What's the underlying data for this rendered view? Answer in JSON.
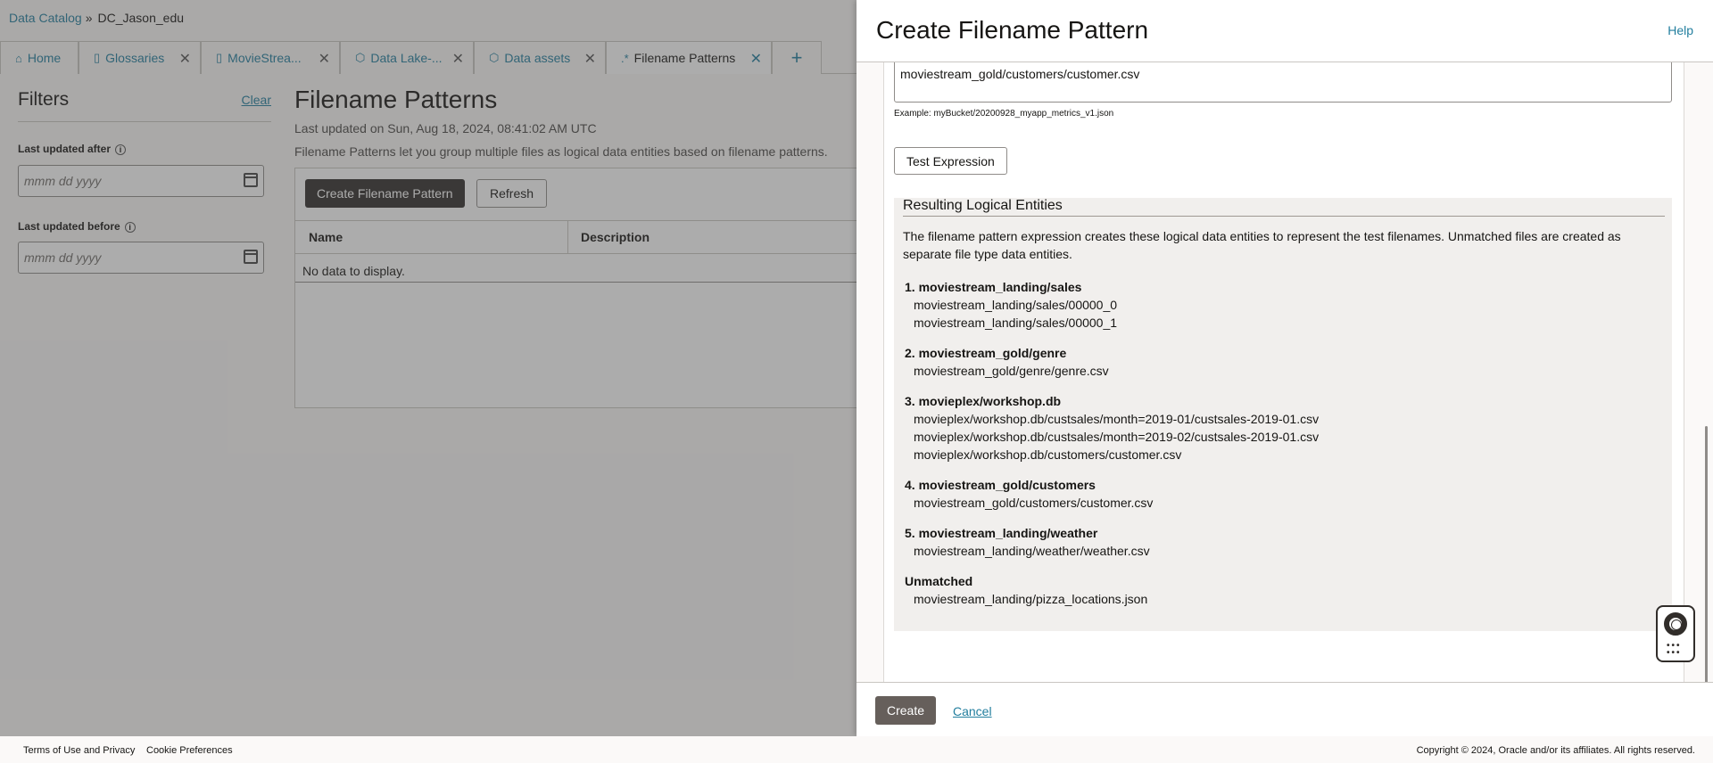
{
  "breadcrumb": {
    "root": "Data Catalog",
    "separator": "»",
    "current": "DC_Jason_edu"
  },
  "tabs": [
    {
      "label": "Home",
      "icon": "home-icon",
      "glyph": "⌂",
      "closable": false
    },
    {
      "label": "Glossaries",
      "icon": "book-icon",
      "glyph": "📖",
      "closable": true
    },
    {
      "label": "MovieStrea...",
      "icon": "book-icon",
      "glyph": "📖",
      "closable": true
    },
    {
      "label": "Data Lake-...",
      "icon": "cube-icon",
      "glyph": "⬡",
      "closable": true
    },
    {
      "label": "Data assets",
      "icon": "cube-icon",
      "glyph": "⬡",
      "closable": true
    },
    {
      "label": "Filename Patterns",
      "icon": "regex-icon",
      "glyph": ".*",
      "closable": true,
      "active": true
    }
  ],
  "add_tab": "+",
  "filters": {
    "title": "Filters",
    "clear": "Clear",
    "after_label": "Last updated after",
    "before_label": "Last updated before",
    "date_placeholder": "mmm dd yyyy",
    "info_glyph": "i"
  },
  "main": {
    "title": "Filename Patterns",
    "updated": "Last updated on Sun, Aug 18, 2024, 08:41:02 AM UTC",
    "description": "Filename Patterns let you group multiple files as logical data entities based on filename patterns.",
    "create_button": "Create Filename Pattern",
    "refresh_button": "Refresh",
    "columns": [
      "Name",
      "Description"
    ],
    "empty": "No data to display."
  },
  "footer": {
    "terms": "Terms of Use and Privacy",
    "cookies": "Cookie Preferences",
    "copyright": "Copyright © 2024, Oracle and/or its affiliates. All rights reserved."
  },
  "drawer": {
    "title": "Create Filename Pattern",
    "help": "Help",
    "expression_visible_line": "moviestream_gold/customers/customer.csv",
    "example": "Example: myBucket/20200928_myapp_metrics_v1.json",
    "test_button": "Test Expression",
    "results_title": "Resulting Logical Entities",
    "results_intro": "The filename pattern expression creates these logical data entities to represent the test filenames. Unmatched files are created as separate file type data entities.",
    "entities": [
      {
        "name": "1. moviestream_landing/sales",
        "files": [
          "moviestream_landing/sales/00000_0",
          "moviestream_landing/sales/00000_1"
        ]
      },
      {
        "name": "2. moviestream_gold/genre",
        "files": [
          "moviestream_gold/genre/genre.csv"
        ]
      },
      {
        "name": "3. movieplex/workshop.db",
        "files": [
          "movieplex/workshop.db/custsales/month=2019-01/custsales-2019-01.csv",
          "movieplex/workshop.db/custsales/month=2019-02/custsales-2019-01.csv",
          "movieplex/workshop.db/customers/customer.csv"
        ]
      },
      {
        "name": "4. moviestream_gold/customers",
        "files": [
          "moviestream_gold/customers/customer.csv"
        ]
      },
      {
        "name": "5. moviestream_landing/weather",
        "files": [
          "moviestream_landing/weather/weather.csv"
        ]
      },
      {
        "name": "Unmatched",
        "files": [
          "moviestream_landing/pizza_locations.json"
        ]
      }
    ],
    "create_button": "Create",
    "cancel_link": "Cancel"
  }
}
